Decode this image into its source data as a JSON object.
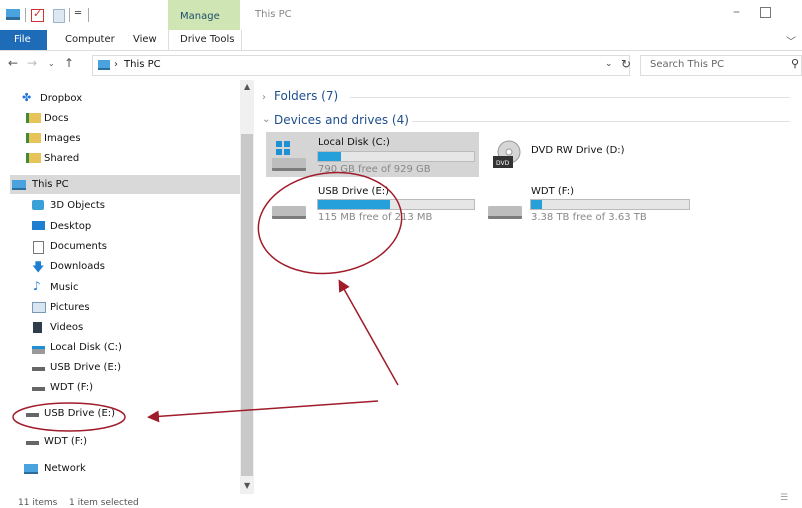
{
  "titlebar": {
    "contextual_tab": "Manage",
    "window_title": "This PC",
    "minimize_glyph": "–"
  },
  "ribbon": {
    "tabs": [
      "File",
      "Computer",
      "View",
      "Drive Tools"
    ]
  },
  "address": {
    "path": "This PC",
    "search_placeholder": "Search This PC"
  },
  "nav": {
    "quick": [
      {
        "label": "Dropbox",
        "icon": "dropbox-icon"
      },
      {
        "label": "Docs",
        "icon": "shared-folder-icon"
      },
      {
        "label": "Images",
        "icon": "shared-folder-icon"
      },
      {
        "label": "Shared",
        "icon": "shared-folder-icon"
      }
    ],
    "this_pc": "This PC",
    "pc_items": [
      {
        "label": "3D Objects",
        "icon": "3d-objects-icon"
      },
      {
        "label": "Desktop",
        "icon": "desktop-icon"
      },
      {
        "label": "Documents",
        "icon": "documents-icon"
      },
      {
        "label": "Downloads",
        "icon": "downloads-icon"
      },
      {
        "label": "Music",
        "icon": "music-icon"
      },
      {
        "label": "Pictures",
        "icon": "pictures-icon"
      },
      {
        "label": "Videos",
        "icon": "videos-icon"
      },
      {
        "label": "Local Disk (C:)",
        "icon": "local-disk-icon"
      },
      {
        "label": "USB Drive (E:)",
        "icon": "drive-icon"
      },
      {
        "label": "WDT (F:)",
        "icon": "drive-icon"
      }
    ],
    "usb_root": "USB Drive (E:)",
    "wdt_root": "WDT (F:)",
    "network": "Network"
  },
  "content": {
    "folders_group": "Folders (7)",
    "devices_group": "Devices and drives (4)",
    "drives": [
      {
        "name": "Local Disk (C:)",
        "free": "790 GB free of 929 GB",
        "used_fraction": 0.15
      },
      {
        "name": "DVD RW Drive (D:)"
      },
      {
        "name": "USB Drive (E:)",
        "free": "115 MB free of 213 MB",
        "used_fraction": 0.46
      },
      {
        "name": "WDT (F:)",
        "free": "3.38 TB free of 3.63 TB",
        "used_fraction": 0.07
      }
    ]
  },
  "status": {
    "items": "11 items",
    "selected": "1 item selected"
  },
  "colors": {
    "annotation": "#a01c2a",
    "accent": "#1e6bb8",
    "bar_fill": "#26a0da"
  }
}
